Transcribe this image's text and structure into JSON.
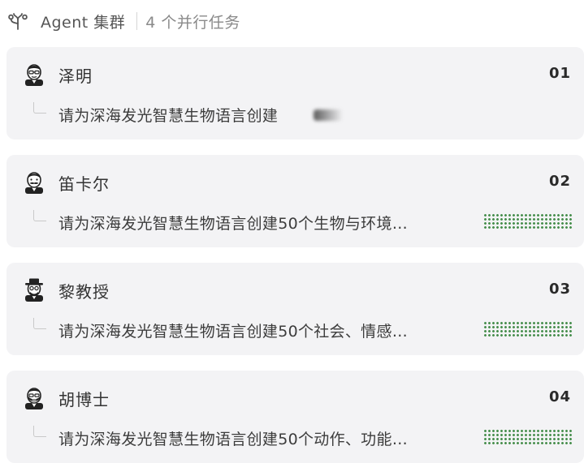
{
  "header": {
    "title": "Agent 集群",
    "subtitle": "4 个并行任务"
  },
  "agents": [
    {
      "name": "泽明",
      "number": "01",
      "task": "请为深海发光智慧生物语言创建",
      "avatar": "man-avatar-icon",
      "status": "loading"
    },
    {
      "name": "笛卡尔",
      "number": "02",
      "task": "请为深海发光智慧生物语言创建50个生物与环境…",
      "avatar": "mustache-man-avatar-icon",
      "status": "running"
    },
    {
      "name": "黎教授",
      "number": "03",
      "task": "请为深海发光智慧生物语言创建50个社会、情感…",
      "avatar": "hat-man-avatar-icon",
      "status": "running"
    },
    {
      "name": "胡博士",
      "number": "04",
      "task": "请为深海发光智慧生物语言创建50个动作、功能…",
      "avatar": "bearded-man-avatar-icon",
      "status": "running"
    }
  ],
  "colors": {
    "card_bg": "#f3f3f5",
    "progress_green": "#3f8a45"
  }
}
